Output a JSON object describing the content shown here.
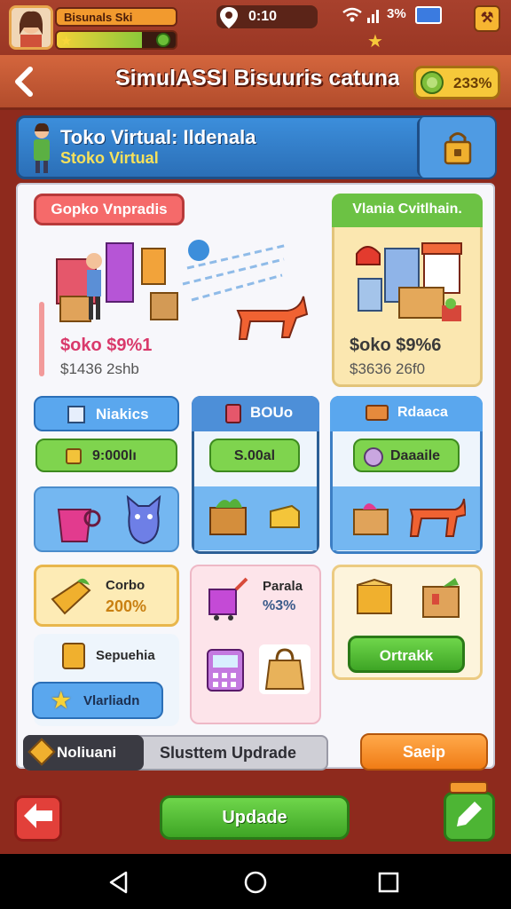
{
  "status": {
    "player_name": "Bisunals Ski",
    "clock": "0:10",
    "battery": "3%",
    "xp_fraction": 0.72
  },
  "header": {
    "title": "SimulASSI Bisuuris catunas",
    "coins": "233%"
  },
  "banner": {
    "title": "Toko Virtual: Ildenala",
    "subtitle": "Stoko Virtual"
  },
  "stores": {
    "left": {
      "tag": "Gopko Vnpradis",
      "price": "$oko $9%1",
      "sub": "$1436 2shb"
    },
    "right": {
      "tag": "Vlania Cvitlhain.",
      "price": "$oko $9%6",
      "sub": "$3636 26f0"
    }
  },
  "grid": {
    "col1_header": "Niakics",
    "col1_pill": "9:000lı",
    "col2_header": "BOUo",
    "col2_pill": "S.00al",
    "col3_header": "Rdaaca",
    "col3_pill": "Daaaile"
  },
  "row3": {
    "combo_label": "Corbo",
    "combo_value": "200%",
    "parala_label": "Parala",
    "parala_value": "%3%",
    "item_label": "Sepuehia",
    "star_label": "Vlarliadn",
    "action_label": "Ortrakk"
  },
  "bottom": {
    "tab_active": "Noliuani",
    "tab_inactive": "Slusttem Updrade",
    "save_label": "Saeip",
    "update_label": "Updade"
  },
  "colors": {
    "primary_blue": "#3c8edb",
    "accent_orange": "#f07c16",
    "accent_green": "#4db534",
    "background_red": "#8e2a1d"
  }
}
